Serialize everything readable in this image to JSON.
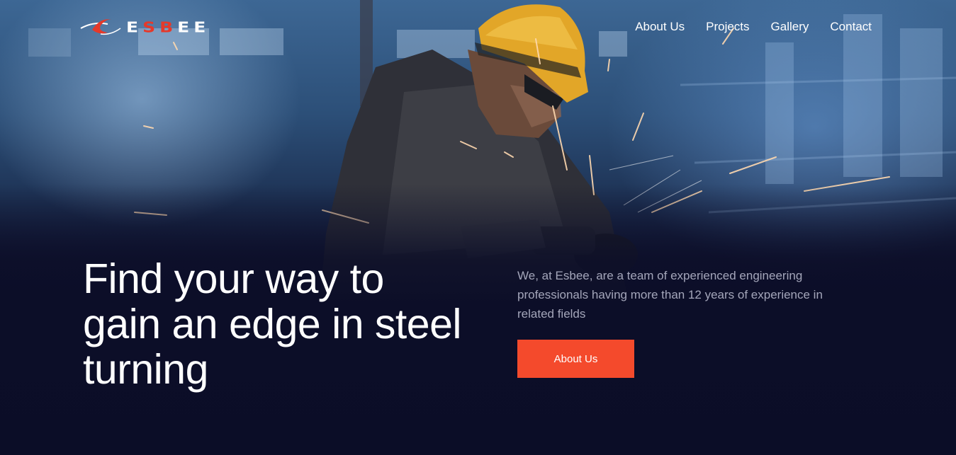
{
  "brand": {
    "name_parts": [
      "E",
      "SB",
      "EE"
    ],
    "accent_color": "#e5392a",
    "logo_icon": "swoosh-logo-icon"
  },
  "nav": {
    "items": [
      {
        "label": "About Us"
      },
      {
        "label": "Projects"
      },
      {
        "label": "Gallery"
      },
      {
        "label": "Contact"
      }
    ]
  },
  "hero": {
    "headline_lines": [
      "Find your way to",
      "gain an edge in steel",
      "turning"
    ],
    "description": "We, at Esbee, are a team of experienced engineering professionals having more than 12 years of experience in related fields",
    "cta_label": "About Us",
    "cta_color": "#f44a2c",
    "background_color": "#0c0e28"
  }
}
